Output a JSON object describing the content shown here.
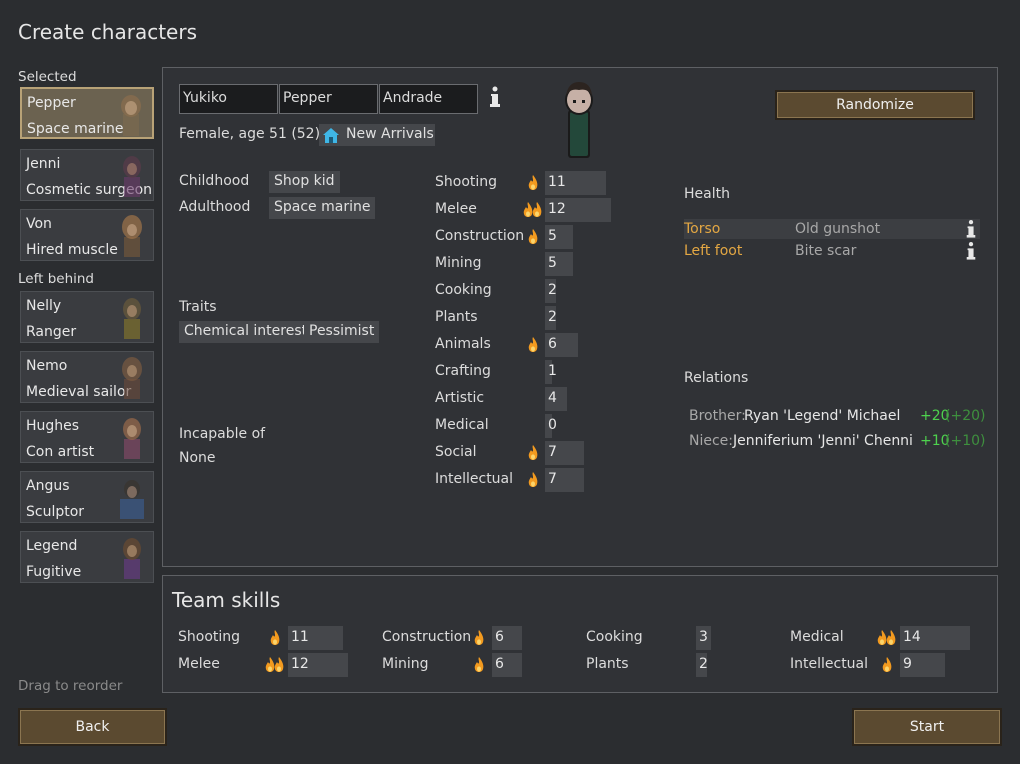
{
  "title": "Create characters",
  "sidebar": {
    "selected_label": "Selected",
    "left_behind_label": "Left behind",
    "drag_hint": "Drag to reorder",
    "selected": [
      {
        "name": "Pepper",
        "title": "Space marine"
      },
      {
        "name": "Jenni",
        "title": "Cosmetic surgeon"
      },
      {
        "name": "Von",
        "title": "Hired muscle"
      }
    ],
    "left_behind": [
      {
        "name": "Nelly",
        "title": "Ranger"
      },
      {
        "name": "Nemo",
        "title": "Medieval sailor"
      },
      {
        "name": "Hughes",
        "title": "Con artist"
      },
      {
        "name": "Angus",
        "title": "Sculptor"
      },
      {
        "name": "Legend",
        "title": "Fugitive"
      }
    ]
  },
  "character": {
    "first_name": "Yukiko",
    "nick_name": "Pepper",
    "last_name": "Andrade",
    "summary": "Female, age 51 (52)",
    "faction": "New Arrivals",
    "randomize_label": "Randomize",
    "backstory": {
      "childhood_label": "Childhood",
      "childhood": "Shop kid",
      "adulthood_label": "Adulthood",
      "adulthood": "Space marine"
    },
    "traits_label": "Traits",
    "traits": [
      "Chemical interest",
      "Pessimist"
    ],
    "incapable_label": "Incapable of",
    "incapable": "None",
    "skills": [
      {
        "name": "Shooting",
        "level": 11,
        "passion": 1
      },
      {
        "name": "Melee",
        "level": 12,
        "passion": 2
      },
      {
        "name": "Construction",
        "level": 5,
        "passion": 1
      },
      {
        "name": "Mining",
        "level": 5,
        "passion": 0
      },
      {
        "name": "Cooking",
        "level": 2,
        "passion": 0
      },
      {
        "name": "Plants",
        "level": 2,
        "passion": 0
      },
      {
        "name": "Animals",
        "level": 6,
        "passion": 1
      },
      {
        "name": "Crafting",
        "level": 1,
        "passion": 0
      },
      {
        "name": "Artistic",
        "level": 4,
        "passion": 0
      },
      {
        "name": "Medical",
        "level": 0,
        "passion": 0
      },
      {
        "name": "Social",
        "level": 7,
        "passion": 1
      },
      {
        "name": "Intellectual",
        "level": 7,
        "passion": 1
      }
    ],
    "health_label": "Health",
    "health": [
      {
        "part": "Torso",
        "condition": "Old gunshot"
      },
      {
        "part": "Left foot",
        "condition": "Bite scar"
      }
    ],
    "relations_label": "Relations",
    "relations": [
      {
        "relation": "Brother:",
        "name": "Ryan 'Legend' Michael",
        "opinion": "+20",
        "opinion_paren": "(+20)"
      },
      {
        "relation": "Niece:",
        "name": "Jenniferium 'Jenni' Chenni",
        "opinion": "+10",
        "opinion_paren": "(+10)"
      }
    ]
  },
  "team": {
    "title": "Team skills",
    "skills": [
      {
        "name": "Shooting",
        "level": 11,
        "passion": 1
      },
      {
        "name": "Melee",
        "level": 12,
        "passion": 2
      },
      {
        "name": "Construction",
        "level": 6,
        "passion": 1
      },
      {
        "name": "Mining",
        "level": 6,
        "passion": 1
      },
      {
        "name": "Cooking",
        "level": 3,
        "passion": 0
      },
      {
        "name": "Plants",
        "level": 2,
        "passion": 0
      },
      {
        "name": "Medical",
        "level": 14,
        "passion": 2
      },
      {
        "name": "Intellectual",
        "level": 9,
        "passion": 1
      }
    ]
  },
  "footer": {
    "back_label": "Back",
    "start_label": "Start"
  },
  "colors": {
    "bg": "#2b2d30",
    "panel": "#303236",
    "button_brown": "#5b4a30",
    "selected_border": "#b8a277",
    "heading_yellow": "#e7e27a",
    "injury_orange": "#e3a743",
    "opinion_green": "#4ed24e",
    "passion_flame": "#f29a1f"
  },
  "icons": {
    "info": "info-icon",
    "faction": "house-icon",
    "passion": "flame-icon"
  }
}
